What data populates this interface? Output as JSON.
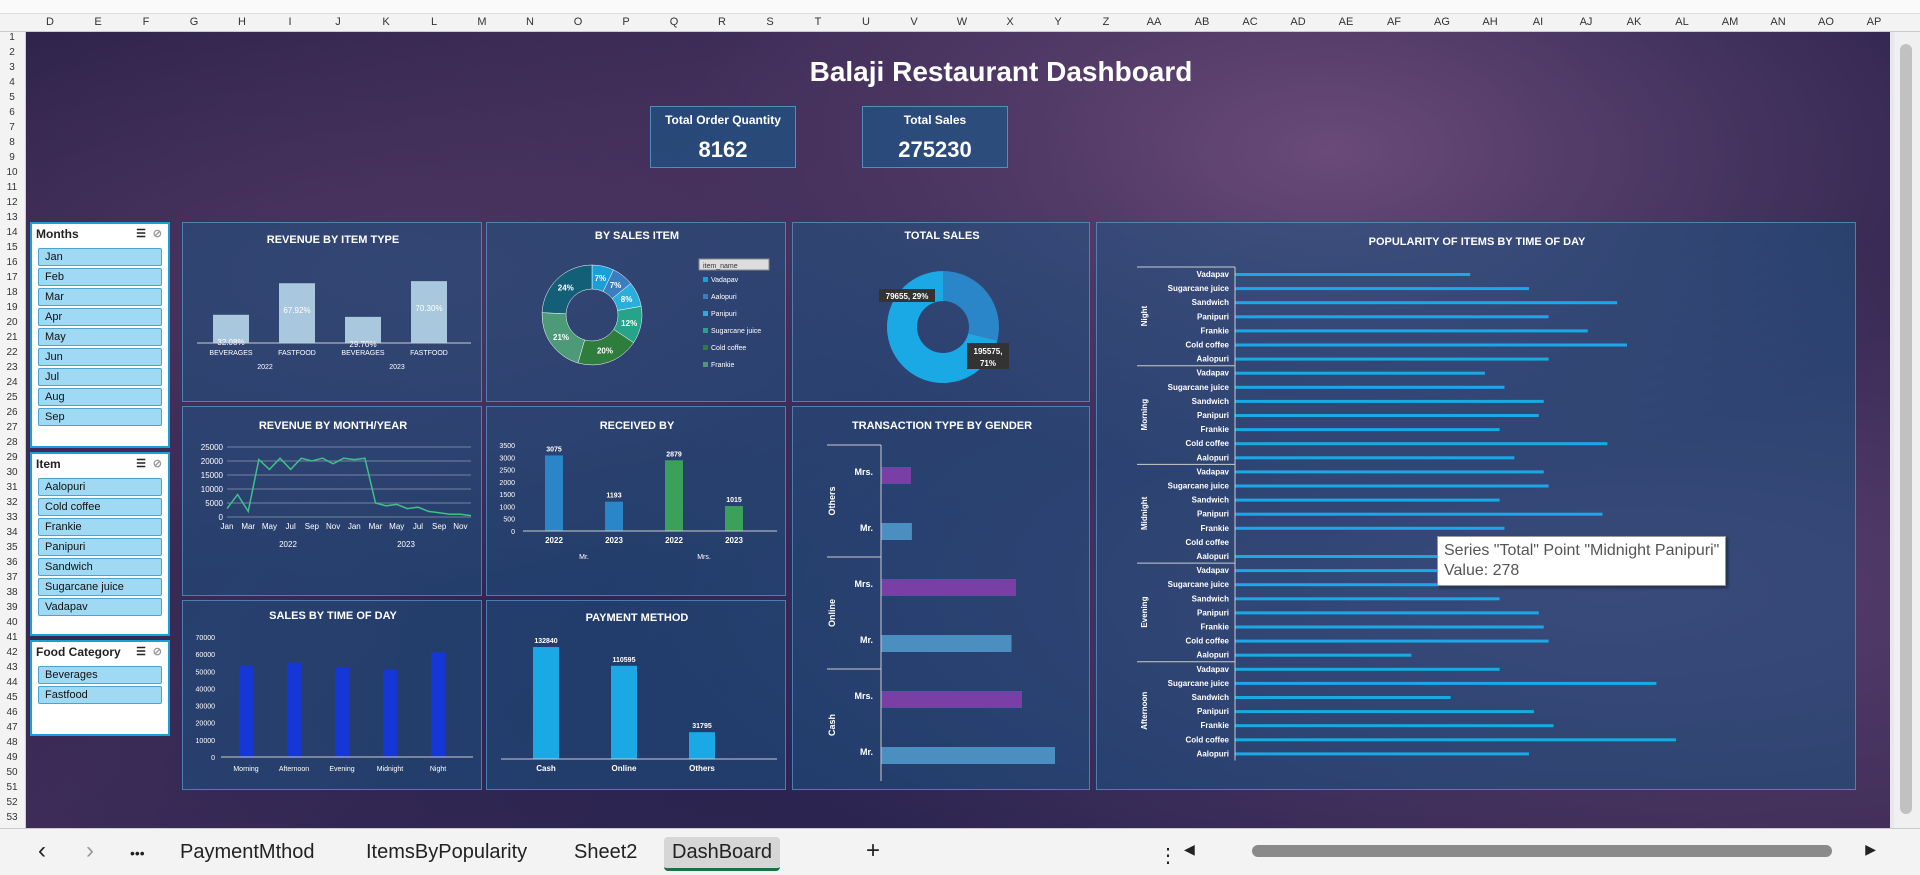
{
  "columns": [
    "D",
    "E",
    "F",
    "G",
    "H",
    "I",
    "J",
    "K",
    "L",
    "M",
    "N",
    "O",
    "P",
    "Q",
    "R",
    "S",
    "T",
    "U",
    "V",
    "W",
    "X",
    "Y",
    "Z",
    "AA",
    "AB",
    "AC",
    "AD",
    "AE",
    "AF",
    "AG",
    "AH",
    "AI",
    "AJ",
    "AK",
    "AL",
    "AM",
    "AN",
    "AO",
    "AP"
  ],
  "rows": [
    "1",
    "2",
    "3",
    "4",
    "5",
    "6",
    "7",
    "8",
    "9",
    "10",
    "11",
    "12",
    "13",
    "14",
    "15",
    "16",
    "17",
    "18",
    "19",
    "20",
    "21",
    "22",
    "23",
    "24",
    "25",
    "26",
    "27",
    "28",
    "29",
    "30",
    "31",
    "32",
    "33",
    "34",
    "35",
    "36",
    "37",
    "38",
    "39",
    "40",
    "41",
    "42",
    "43",
    "44",
    "45",
    "46",
    "47",
    "48",
    "49",
    "50",
    "51",
    "52",
    "53"
  ],
  "dashboard": {
    "title": "Balaji Restaurant Dashboard"
  },
  "kpis": {
    "orders_label": "Total Order Quantity",
    "orders_value": "8162",
    "sales_label": "Total Sales",
    "sales_value": "275230"
  },
  "slicers": {
    "months": {
      "title": "Months",
      "items": [
        "Jan",
        "Feb",
        "Mar",
        "Apr",
        "May",
        "Jun",
        "Jul",
        "Aug",
        "Sep"
      ]
    },
    "item": {
      "title": "Item",
      "items": [
        "Aalopuri",
        "Cold coffee",
        "Frankie",
        "Panipuri",
        "Sandwich",
        "Sugarcane juice",
        "Vadapav"
      ]
    },
    "food": {
      "title": "Food Category",
      "items": [
        "Beverages",
        "Fastfood"
      ]
    }
  },
  "chart_data": [
    {
      "type": "bar",
      "title": "REVENUE BY ITEM TYPE",
      "categories": [
        "BEVERAGES",
        "FASTFOOD",
        "BEVERAGES",
        "FASTFOOD"
      ],
      "groups": [
        "2022",
        "2023"
      ],
      "values": [
        32.08,
        67.92,
        29.7,
        70.3
      ],
      "labels": [
        "32.08%",
        "67.92%",
        "29.70%",
        "70.30%"
      ]
    },
    {
      "type": "pie",
      "title": "BY SALES ITEM",
      "filter": "item_name",
      "legend": [
        "Vadapav",
        "Aalopuri",
        "Panipuri",
        "Sugarcane juice",
        "Cold coffee",
        "Frankie"
      ],
      "values": [
        7,
        7,
        8,
        12,
        20,
        21,
        24
      ],
      "labels": [
        "7%",
        "7%",
        "8%",
        "12%",
        "20%",
        "21%",
        "24%"
      ],
      "colors": [
        "#1b9fd9",
        "#3a7ec0",
        "#2aaedb",
        "#27a38a",
        "#2e7d3c",
        "#4d9a78",
        "#135f78"
      ]
    },
    {
      "type": "pie",
      "title": "TOTAL SALES",
      "values": [
        79655,
        195575
      ],
      "labels": [
        "79655, 29%",
        "195575, 71%"
      ]
    },
    {
      "type": "bar",
      "title": "POPULARITY OF ITEMS BY TIME OF DAY",
      "groups": [
        "Night",
        "Morning",
        "Midnight",
        "Evening",
        "Afternoon"
      ],
      "categories": [
        "Vadapav",
        "Sugarcane juice",
        "Sandwich",
        "Panipuri",
        "Frankie",
        "Cold coffee",
        "Aalopuri"
      ],
      "values": [
        [
          240,
          300,
          390,
          320,
          360,
          400,
          320
        ],
        [
          255,
          275,
          315,
          310,
          270,
          380,
          285
        ],
        [
          315,
          320,
          270,
          375,
          275,
          0,
          278
        ],
        [
          280,
          275,
          270,
          310,
          315,
          320,
          180
        ],
        [
          270,
          430,
          220,
          305,
          325,
          450,
          300
        ]
      ]
    },
    {
      "type": "line",
      "title": "REVENUE BY MONTH/YEAR",
      "ylim": [
        0,
        25000
      ],
      "yticks": [
        "25000",
        "20000",
        "15000",
        "10000",
        "5000",
        "0"
      ],
      "xticks": [
        "Jan",
        "Mar",
        "May",
        "Jul",
        "Sep",
        "Nov",
        "Jan",
        "Mar",
        "May",
        "Jul",
        "Sep",
        "Nov"
      ],
      "groups": [
        "2022",
        "2023"
      ],
      "values": [
        3000,
        8000,
        2000,
        20500,
        17000,
        21000,
        17000,
        21000,
        20000,
        21000,
        19000,
        21000,
        20500,
        21000,
        5000,
        4000,
        4500,
        3000,
        3500,
        2000,
        1500,
        1000,
        1000,
        500
      ]
    },
    {
      "type": "bar",
      "title": "RECEIVED BY",
      "yticks": [
        "3500",
        "3000",
        "2500",
        "2000",
        "1500",
        "1000",
        "500",
        "0"
      ],
      "categories": [
        "2022",
        "2023",
        "2022",
        "2023"
      ],
      "groups": [
        "Mr.",
        "Mrs."
      ],
      "values": [
        3075,
        1193,
        2879,
        1015
      ],
      "labels": [
        "3075",
        "1193",
        "2879",
        "1015"
      ]
    },
    {
      "type": "bar",
      "title": "TRANSACTION TYPE BY GENDER",
      "groups": [
        "Others",
        "Online",
        "Cash"
      ],
      "categories": [
        "Mrs.",
        "Mr.",
        "Mrs.",
        "Mr.",
        "Mrs.",
        "Mr."
      ],
      "values": [
        1000,
        1030,
        4500,
        4350,
        4700,
        5800
      ]
    },
    {
      "type": "bar",
      "title": "SALES BY TIME OF DAY",
      "yticks": [
        "70000",
        "60000",
        "50000",
        "40000",
        "30000",
        "20000",
        "10000",
        "0"
      ],
      "categories": [
        "Morning",
        "Afternoon",
        "Evening",
        "Midnight",
        "Night"
      ],
      "values": [
        53000,
        55000,
        52000,
        51000,
        61000
      ]
    },
    {
      "type": "bar",
      "title": "PAYMENT METHOD",
      "categories": [
        "Cash",
        "Online",
        "Others"
      ],
      "values": [
        132840,
        110595,
        31795
      ],
      "labels": [
        "132840",
        "110595",
        "31795"
      ]
    }
  ],
  "tooltip": {
    "line1": "Series \"Total\" Point \"Midnight Panipuri\"",
    "line2": "Value: 278"
  },
  "tabs": {
    "t1": "PaymentMthod",
    "t2": "ItemsByPopularity",
    "t3": "Sheet2",
    "t4": "DashBoard",
    "add": "+",
    "more": "•••",
    "menu": "⋮",
    "prev": "‹",
    "next": "›"
  }
}
